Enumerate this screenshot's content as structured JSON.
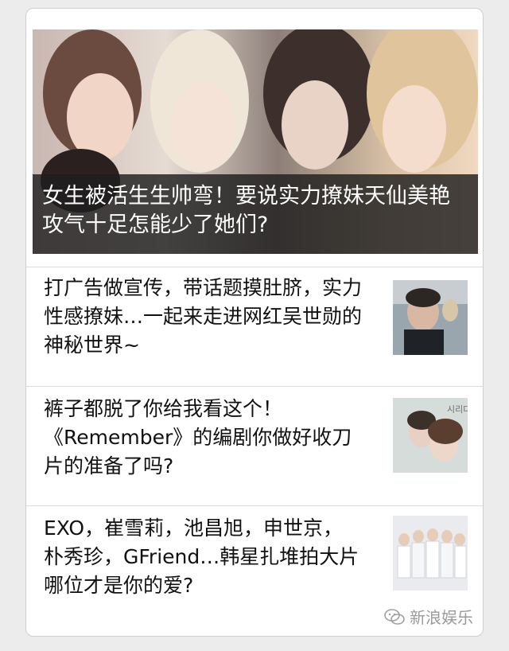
{
  "hero": {
    "title": "女生被活生生帅弯！要说实力撩妹天仙美艳攻气十足怎能少了她们?"
  },
  "articles": [
    {
      "title": "打广告做宣传，带话题摸肚脐，实力性感撩妹…一起来走进网红吴世勋的神秘世界~"
    },
    {
      "title": "裤子都脱了你给我看这个！《Remember》的编剧你做好收刀片的准备了吗?"
    },
    {
      "title": "EXO，崔雪莉，池昌旭，申世京，朴秀珍，GFriend…韩星扎堆拍大片哪位才是你的爱?"
    }
  ],
  "thumb2_text": "시리다",
  "watermark": {
    "icon": "wechat-logo-icon",
    "text": "新浪娱乐"
  },
  "colors": {
    "caption_bg": "#1e1e1e",
    "text": "#111111",
    "divider": "#dcdcdc"
  }
}
